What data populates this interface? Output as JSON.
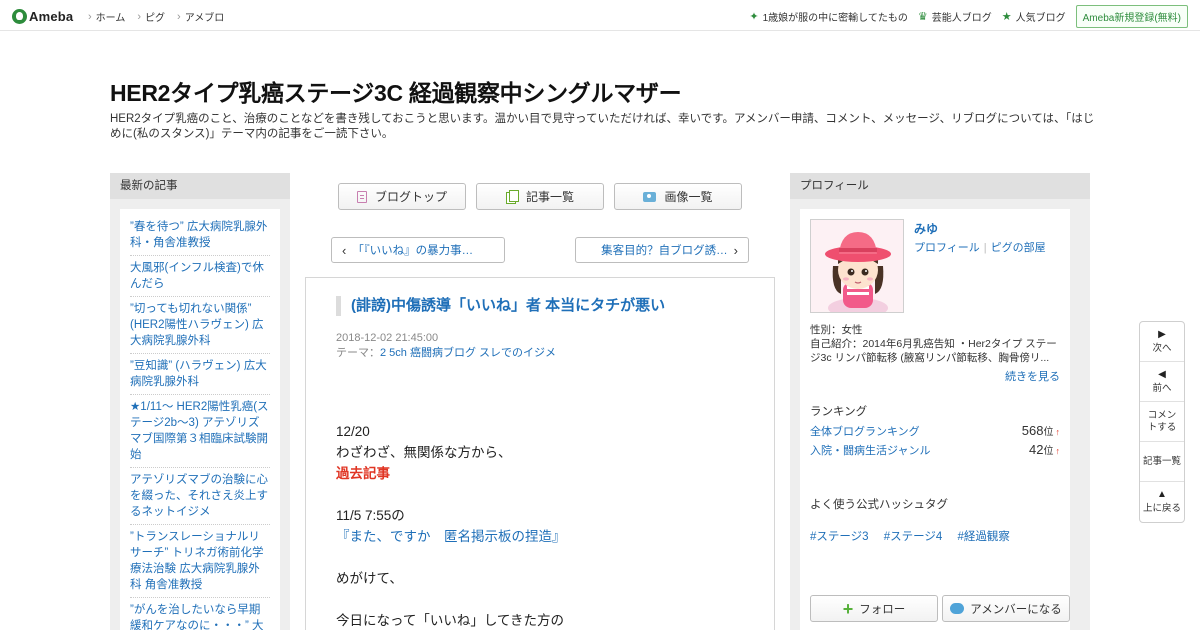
{
  "topbar": {
    "logo": "Ameba",
    "nav": [
      "ホーム",
      "ピグ",
      "アメブロ"
    ],
    "links": [
      {
        "icon": "sparkle-icon",
        "label": "1歳娘が服の中に密輸してたもの"
      },
      {
        "icon": "crown-icon",
        "label": "芸能人ブログ"
      },
      {
        "icon": "star-icon",
        "label": "人気ブログ"
      }
    ],
    "register": "Ameba新規登録(無料)"
  },
  "header": {
    "title": "HER2タイプ乳癌ステージ3C 経過観察中シングルマザー",
    "description": "HER2タイプ乳癌のこと、治療のことなどを書き残しておこうと思います。温かい目で見守っていただければ、幸いです。アメンバー申請、コメント、メッセージ、リブログについては、「はじめに(私のスタンス)」テーマ内の記事をご一読下さい。"
  },
  "recent": {
    "heading": "最新の記事",
    "items": [
      "”春を待つ” 広大病院乳腺外科・角舎准教授",
      "大風邪(インフル検査)で休んだら",
      "”切っても切れない関係” (HER2陽性ハラヴェン) 広大病院乳腺外科",
      "”豆知識” (ハラヴェン) 広大病院乳腺外科",
      "★1/11～ HER2陽性乳癌(ステージ2b～3) アテゾリズマブ国際第３相臨床試験開始",
      "アテゾリズマブの治験に心を綴った、それさえ炎上するネットイジメ",
      "”トランスレーショナルリサーチ” トリネガ術前化学療法治験 広大病院乳腺外科 角舎准教授",
      "”がんを治したいなら早期緩和ケアなのに・・・” 大津秀一緩和医"
    ]
  },
  "toolbar": {
    "top": "ブログトップ",
    "list": "記事一覧",
    "images": "画像一覧"
  },
  "pager": {
    "prev": "「『いいね』の暴力事…",
    "next": "集客目的？自ブログ誘…"
  },
  "article": {
    "title": "(誹謗)中傷誘導「いいね」者 本当にタチが悪い",
    "date": "2018-12-02 21:45:00",
    "theme_label": "テーマ：",
    "theme": "2 5ch 癌闘病ブログ スレでのイジメ",
    "line1": "12/20",
    "line2": "わざわざ、無関係な方から、",
    "link1": "過去記事",
    "line3": "11/5 7:55の",
    "link2": "『また、ですか　匿名掲示板の捏造』",
    "line4": "めがけて、",
    "line5": "今日になって「いいね」してきた方の"
  },
  "profile": {
    "heading": "プロフィール",
    "name": "みゆ",
    "link_profile": "プロフィール",
    "link_room": "ピグの部屋",
    "gender": "性別：女性",
    "intro": "自己紹介：2014年6月乳癌告知 ・Her2タイプ ステージ3c リンパ節転移 (腋窩リンパ節転移、胸骨傍リ...",
    "more": "続きを見る",
    "ranking_heading": "ランキング",
    "rankings": [
      {
        "label": "全体ブログランキング",
        "value": "568",
        "unit": "位",
        "arrow": "↑"
      },
      {
        "label": "入院・闘病生活ジャンル",
        "value": "42",
        "unit": "位",
        "arrow": "↑"
      }
    ],
    "tags_heading": "よく使う公式ハッシュタグ",
    "tags": [
      "#ステージ3",
      "#ステージ4",
      "#経過観察"
    ],
    "follow": "フォロー",
    "amember": "アメンバーになる"
  },
  "floatnav": {
    "next": "次へ",
    "prev": "前へ",
    "comment": "コメントする",
    "list": "記事一覧",
    "top": "上に戻る"
  },
  "colors": {
    "accent_green": "#2d8c3c",
    "link_blue": "#1f6fb8",
    "alert_red": "#e03524"
  }
}
